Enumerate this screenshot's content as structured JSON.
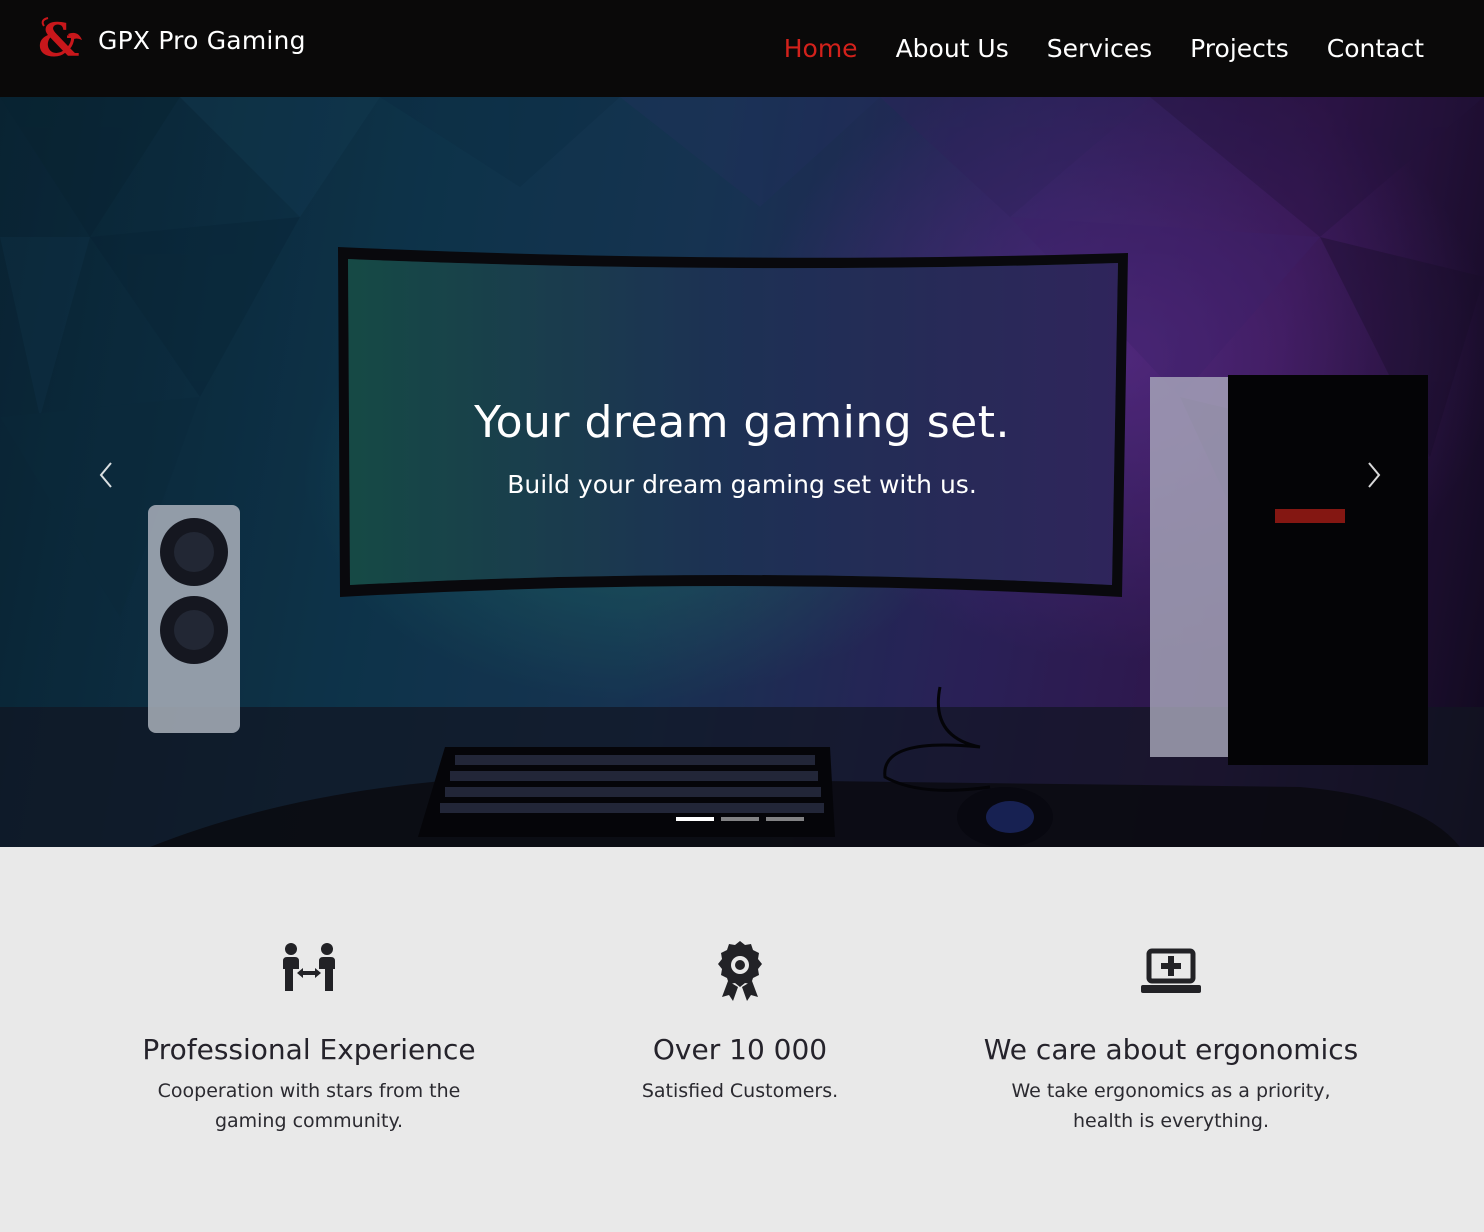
{
  "header": {
    "brand": "GPX Pro Gaming",
    "logo_icon": "ampersand-dragon-logo",
    "nav": [
      {
        "label": "Home",
        "active": true
      },
      {
        "label": "About Us",
        "active": false
      },
      {
        "label": "Services",
        "active": false
      },
      {
        "label": "Projects",
        "active": false
      },
      {
        "label": "Contact",
        "active": false
      }
    ]
  },
  "hero": {
    "title": "Your dream gaming set.",
    "subtitle": "Build your dream gaming set with us.",
    "slides_count": 3,
    "active_slide": 1,
    "prev_icon": "chevron-left-icon",
    "next_icon": "chevron-right-icon"
  },
  "features": [
    {
      "icon": "people-cooperation-icon",
      "title": "Professional Experience",
      "text": "Cooperation with stars from the gaming community."
    },
    {
      "icon": "award-badge-icon",
      "title": "Over 10 000",
      "text": "Satisfied Customers."
    },
    {
      "icon": "laptop-medical-icon",
      "title": "We care about ergonomics",
      "text": "We take ergonomics as a priority, health is everything."
    }
  ],
  "colors": {
    "nav_bg": "#0a0909",
    "accent_red": "#d3211b",
    "features_bg": "#e9e9e9",
    "text_dark": "#25232b"
  }
}
